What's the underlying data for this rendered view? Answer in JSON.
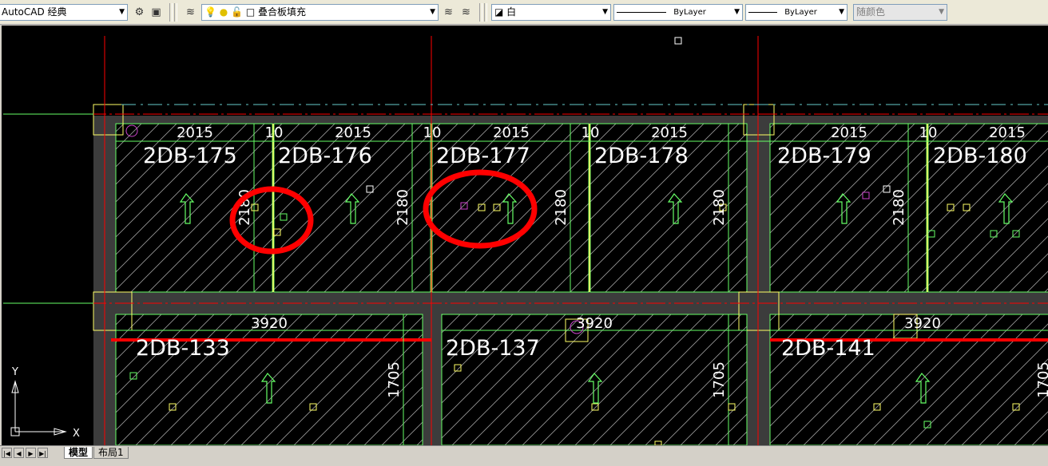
{
  "toolbar": {
    "workspace": "AutoCAD 经典",
    "layer": "叠合板填充",
    "color": "白",
    "linetype": "ByLayer",
    "lineweight": "ByLayer",
    "plotstyle": "随颜色"
  },
  "drawing": {
    "dims_top": [
      "2015",
      "10",
      "2015",
      "10",
      "2015",
      "10",
      "2015",
      "2015",
      "10",
      "2015"
    ],
    "dims_bottom": [
      "3920",
      "3920",
      "3920"
    ],
    "dims_vertical_top": [
      "2180",
      "2180",
      "2180",
      "2180",
      "2180"
    ],
    "dims_vertical_bottom": [
      "1705",
      "1705",
      "1705"
    ],
    "slabs_top": [
      "2DB-175",
      "2DB-176",
      "2DB-177",
      "2DB-178",
      "2DB-179",
      "2DB-180"
    ],
    "slabs_bottom": [
      "2DB-133",
      "2DB-137",
      "2DB-141"
    ],
    "ucs": {
      "x": "X",
      "y": "Y"
    },
    "colors": {
      "frame": "#3c3c3c",
      "panel_edge": "#66ff66",
      "gridline": "#ff0000",
      "marker": "#ff0000",
      "dim": "#ffffff",
      "hatch": "#9a9a9a",
      "column": "#ffff66"
    }
  },
  "tabs": {
    "model": "模型",
    "layout": "布局1"
  }
}
